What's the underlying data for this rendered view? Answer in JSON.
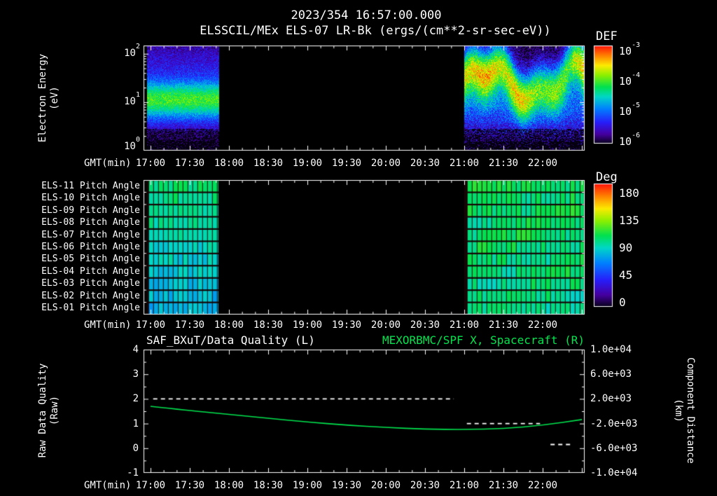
{
  "header": {
    "timestamp": "2023/354 16:57:00.000",
    "title": "ELSSCIL/MEx ELS-07 LR-Bk  (ergs/(cm**2-sr-sec-eV))"
  },
  "xaxis": {
    "label": "GMT(min)",
    "ticks": [
      "17:00",
      "17:30",
      "18:00",
      "18:30",
      "19:00",
      "19:30",
      "20:00",
      "20:30",
      "21:00",
      "21:30",
      "22:00"
    ]
  },
  "energy_panel": {
    "ylabel_line1": "Electron Energy",
    "ylabel_line2": "(eV)",
    "yticks": [
      {
        "b": "10",
        "e": "2"
      },
      {
        "b": "10",
        "e": "1"
      },
      {
        "b": "10",
        "e": "0"
      }
    ],
    "colorbar_title": "DEF",
    "colorbar_ticks": [
      {
        "b": "10",
        "e": "-3"
      },
      {
        "b": "10",
        "e": "-4"
      },
      {
        "b": "10",
        "e": "-5"
      },
      {
        "b": "10",
        "e": "-6"
      }
    ]
  },
  "pitch_panel": {
    "rows": [
      "ELS-11 Pitch Angle",
      "ELS-10 Pitch Angle",
      "ELS-09 Pitch Angle",
      "ELS-08 Pitch Angle",
      "ELS-07 Pitch Angle",
      "ELS-06 Pitch Angle",
      "ELS-05 Pitch Angle",
      "ELS-04 Pitch Angle",
      "ELS-03 Pitch Angle",
      "ELS-02 Pitch Angle",
      "ELS-01 Pitch Angle"
    ],
    "colorbar_title": "Deg",
    "colorbar_ticks": [
      "180",
      "135",
      "90",
      "45",
      "0"
    ]
  },
  "line_panel": {
    "left_title": "SAF_BXuT/Data Quality (L)",
    "right_title": "MEXORBMC/SPF X, Spacecraft (R)",
    "left_ylabel_line1": "Raw Data Quality",
    "left_ylabel_line2": "(Raw)",
    "right_ylabel_line1": "Component Distance",
    "right_ylabel_line2": "(km)",
    "left_ticks": [
      "4",
      "3",
      "2",
      "1",
      "0",
      "-1"
    ],
    "right_ticks": [
      "1.0e+04",
      "6.0e+03",
      "2.0e+03",
      "-2.0e+03",
      "-6.0e+03",
      "-1.0e+04"
    ]
  },
  "colors": {
    "background": "#000000",
    "text": "#ffffff",
    "frame": "#ffffff",
    "accent_green": "#00e44e"
  },
  "chart_data": [
    {
      "type": "heatmap",
      "title": "ELSSCIL/MEx ELS-07 LR-Bk",
      "units": "ergs/(cm**2-sr-sec-eV)",
      "xlabel": "GMT(min)",
      "ylabel": "Electron Energy (eV)",
      "x_ticks": [
        "17:00",
        "17:30",
        "18:00",
        "18:30",
        "19:00",
        "19:30",
        "20:00",
        "20:30",
        "21:00",
        "21:30",
        "22:00"
      ],
      "y_scale": "log",
      "y_range_ev": [
        1,
        150
      ],
      "colorbar": {
        "label": "DEF",
        "scale": "log",
        "min": 1e-06,
        "max": 0.001,
        "palette": "rainbow"
      },
      "segments": [
        {
          "start": "16:57",
          "end": "17:52",
          "character": "steady cyan-green band near 8-15 eV with DEF ~3e-5 to 1e-4; faint blue haze 20-100 eV; dark speckle below 2 eV"
        },
        {
          "start": "21:00",
          "end": "22:32",
          "character": "variable structured flux 5-100 eV, green-yellow enhancements up to ~2e-4; cyan 3-10 eV; dark speckle below 2 eV"
        }
      ],
      "gap": {
        "start": "17:52",
        "end": "21:00",
        "character": "no data (black)"
      }
    },
    {
      "type": "heatmap",
      "title": "ELS Pitch Angle panels",
      "rows": [
        "ELS-11",
        "ELS-10",
        "ELS-09",
        "ELS-08",
        "ELS-07",
        "ELS-06",
        "ELS-05",
        "ELS-04",
        "ELS-03",
        "ELS-02",
        "ELS-01"
      ],
      "colorbar": {
        "label": "Deg",
        "min": 0,
        "max": 180,
        "ticks": [
          180,
          135,
          90,
          45,
          0
        ],
        "palette": "rainbow"
      },
      "segments": [
        {
          "start": "16:57",
          "end": "17:52",
          "approx_deg_top_rows": 100,
          "approx_deg_bottom_rows": 78
        },
        {
          "start": "21:00",
          "end": "22:32",
          "approx_deg": 103
        }
      ]
    },
    {
      "type": "line",
      "x_ticks": [
        "17:00",
        "17:30",
        "18:00",
        "18:30",
        "19:00",
        "19:30",
        "20:00",
        "20:30",
        "21:00",
        "21:30",
        "22:00"
      ],
      "left_axis": {
        "label": "Raw Data Quality (Raw)",
        "range": [
          -1,
          4
        ]
      },
      "right_axis": {
        "label": "Component Distance (km)",
        "range": [
          -10000,
          10000
        ]
      },
      "series": [
        {
          "name": "SAF_BXuT/Data Quality (L)",
          "axis": "left",
          "color": "#ffffff",
          "style": "dashed",
          "segments": [
            {
              "x0": "17:02",
              "x1": "20:52",
              "y": 2
            },
            {
              "x0": "21:02",
              "x1": "21:58",
              "y": 1
            },
            {
              "x0": "22:06",
              "x1": "22:22",
              "y": 0.15
            }
          ]
        },
        {
          "name": "MEXORBMC/SPF X, Spacecraft (R)",
          "axis": "right",
          "color": "#00e44e",
          "style": "solid",
          "x": [
            "17:00",
            "17:30",
            "18:00",
            "18:30",
            "19:00",
            "19:30",
            "20:00",
            "20:30",
            "21:00",
            "21:30",
            "22:00",
            "22:30"
          ],
          "y_km": [
            800,
            100,
            -500,
            -1150,
            -1750,
            -2250,
            -2650,
            -2900,
            -2980,
            -2820,
            -2280,
            -1350
          ]
        }
      ]
    }
  ]
}
